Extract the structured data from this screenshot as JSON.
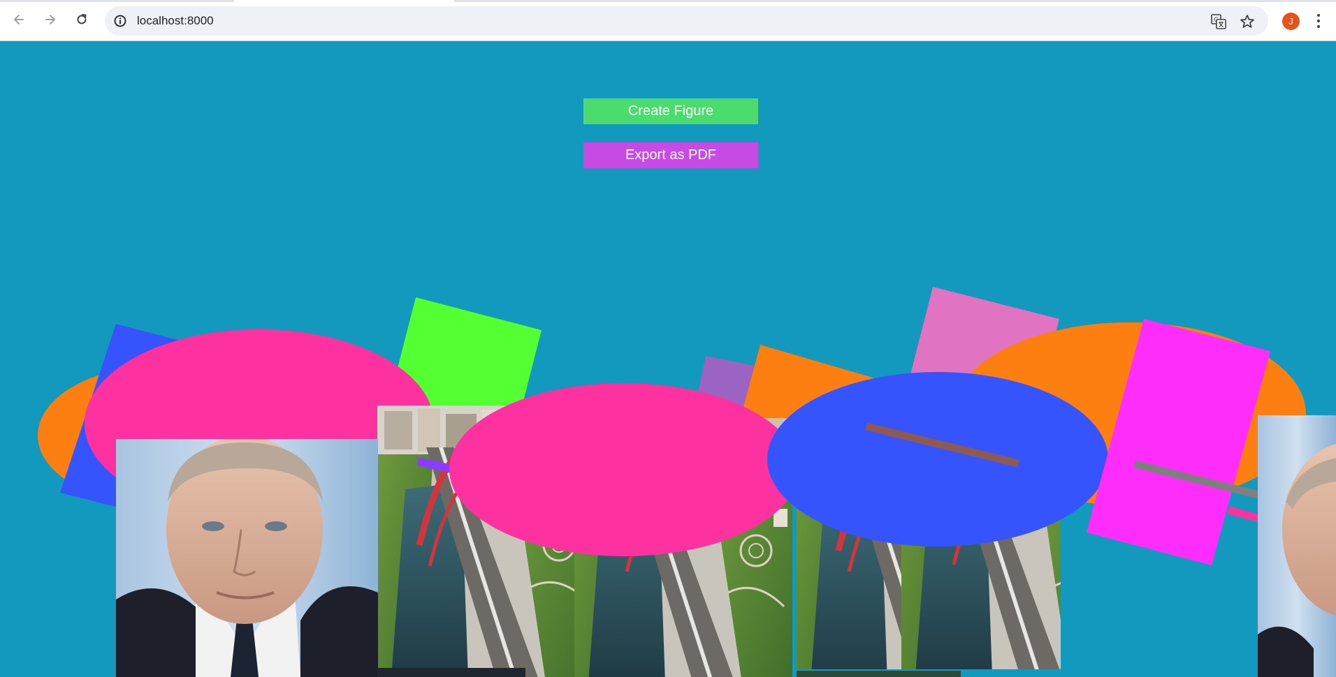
{
  "browser": {
    "url": "localhost:8000",
    "profile_initial": "J",
    "icons": [
      "back-arrow-icon",
      "forward-arrow-icon",
      "reload-icon",
      "site-info-icon",
      "translate-icon",
      "bookmark-star-icon",
      "kebab-menu-icon"
    ]
  },
  "page": {
    "background_color": "#1399bd",
    "create_button_label": "Create Figure",
    "export_button_label": "Export as PDF",
    "create_button_color": "#4bdc6e",
    "export_button_color": "#c84ae4"
  },
  "figure": {
    "shape_colors": {
      "orange": "#fd7f12",
      "blue": "#3554fe",
      "hot_pink": "#fe31a0",
      "green": "#54ff32",
      "purple": "#9b63c2",
      "pink": "#e073c2",
      "magenta": "#fe2dfb",
      "brown": "#8c5a52",
      "gray": "#7f7f7f",
      "violet": "#8a3cff"
    },
    "images": [
      "portrait-photo",
      "bridge-aerial-photo"
    ]
  }
}
